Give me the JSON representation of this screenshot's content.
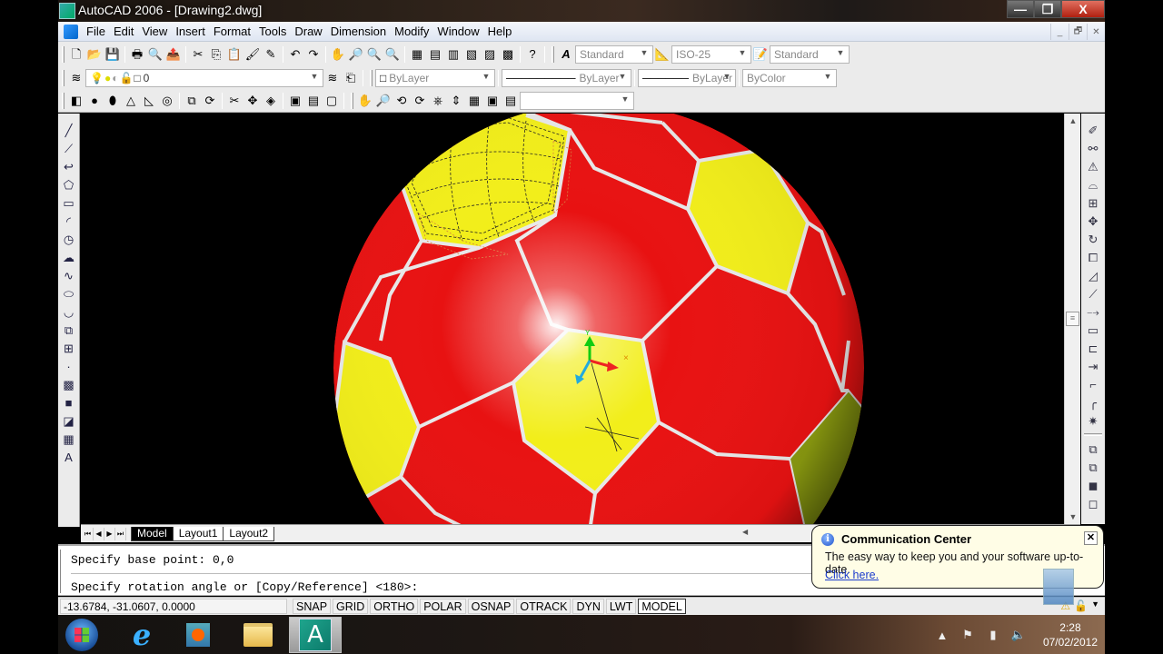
{
  "window": {
    "title": "AutoCAD 2006 - [Drawing2.dwg]",
    "controls": {
      "minimize": "—",
      "restore": "❐",
      "close": "X"
    },
    "mdi_controls": {
      "minimize": "_",
      "restore": "🗗",
      "close": "✕"
    }
  },
  "menubar": {
    "items": [
      "File",
      "Edit",
      "View",
      "Insert",
      "Format",
      "Tools",
      "Draw",
      "Dimension",
      "Modify",
      "Window",
      "Help"
    ]
  },
  "toolbars": {
    "standard_icons": [
      {
        "name": "new-icon",
        "glyph": "🗋"
      },
      {
        "name": "open-icon",
        "glyph": "📂"
      },
      {
        "name": "save-icon",
        "glyph": "💾"
      },
      {
        "name": "plot-icon",
        "glyph": "🖶"
      },
      {
        "name": "plot-preview-icon",
        "glyph": "🔍"
      },
      {
        "name": "publish-icon",
        "glyph": "📤"
      },
      {
        "name": "cut-icon",
        "glyph": "✂"
      },
      {
        "name": "copy-icon",
        "glyph": "⎘"
      },
      {
        "name": "paste-icon",
        "glyph": "📋"
      },
      {
        "name": "match-properties-icon",
        "glyph": "🖌"
      },
      {
        "name": "block-editor-icon",
        "glyph": "✎"
      },
      {
        "name": "undo-icon",
        "glyph": "↶"
      },
      {
        "name": "redo-icon",
        "glyph": "↷"
      },
      {
        "name": "pan-icon",
        "glyph": "✋"
      },
      {
        "name": "zoom-realtime-icon",
        "glyph": "🔎"
      },
      {
        "name": "zoom-window-icon",
        "glyph": "🔍"
      },
      {
        "name": "zoom-previous-icon",
        "glyph": "🔍"
      },
      {
        "name": "properties-icon",
        "glyph": "▦"
      },
      {
        "name": "design-center-icon",
        "glyph": "▤"
      },
      {
        "name": "tool-palettes-icon",
        "glyph": "▥"
      },
      {
        "name": "sheet-set-icon",
        "glyph": "▧"
      },
      {
        "name": "markup-icon",
        "glyph": "▨"
      },
      {
        "name": "calculator-icon",
        "glyph": "▩"
      },
      {
        "name": "help-icon",
        "glyph": "?"
      }
    ],
    "styles": {
      "text_style": "Standard",
      "dim_style": "ISO-25",
      "table_style": "Standard"
    },
    "layers": {
      "current_layer": "0",
      "layer_state_icons": [
        "💡",
        "●",
        "◐",
        "🔓",
        "□"
      ]
    },
    "properties": {
      "color": "ByLayer",
      "linetype": "ByLayer",
      "lineweight": "ByLayer",
      "plotstyle": "ByColor"
    },
    "solids_icons": [
      {
        "name": "box-icon",
        "glyph": "◧"
      },
      {
        "name": "sphere-icon",
        "glyph": "●"
      },
      {
        "name": "cylinder-icon",
        "glyph": "⬮"
      },
      {
        "name": "cone-icon",
        "glyph": "△"
      },
      {
        "name": "wedge-icon",
        "glyph": "◺"
      },
      {
        "name": "torus-icon",
        "glyph": "◎"
      },
      {
        "name": "extrude-icon",
        "glyph": "⧉"
      },
      {
        "name": "revolve-icon",
        "glyph": "⟳"
      },
      {
        "name": "slice-icon",
        "glyph": "✂"
      },
      {
        "name": "section-icon",
        "glyph": "✥"
      },
      {
        "name": "interference-icon",
        "glyph": "◈"
      },
      {
        "name": "setup-drawing-icon",
        "glyph": "▣"
      },
      {
        "name": "setup-view-icon",
        "glyph": "▤"
      },
      {
        "name": "setup-profile-icon",
        "glyph": "▢"
      }
    ],
    "orbit_icons": [
      {
        "name": "3d-pan-icon",
        "glyph": "✋"
      },
      {
        "name": "3d-zoom-icon",
        "glyph": "🔎"
      },
      {
        "name": "3d-orbit-icon",
        "glyph": "⟲"
      },
      {
        "name": "3d-continuous-orbit-icon",
        "glyph": "⟳"
      },
      {
        "name": "3d-swivel-icon",
        "glyph": "⎈"
      },
      {
        "name": "3d-adjust-distance-icon",
        "glyph": "⇕"
      },
      {
        "name": "3d-clip-icon",
        "glyph": "▦"
      },
      {
        "name": "front-clip-icon",
        "glyph": "▣"
      },
      {
        "name": "back-clip-icon",
        "glyph": "▤"
      }
    ],
    "view_combo": ""
  },
  "draw_tools": [
    {
      "name": "line-icon",
      "glyph": "╱"
    },
    {
      "name": "construction-line-icon",
      "glyph": "⟋"
    },
    {
      "name": "polyline-icon",
      "glyph": "↩"
    },
    {
      "name": "polygon-icon",
      "glyph": "⬠"
    },
    {
      "name": "rectangle-icon",
      "glyph": "▭"
    },
    {
      "name": "arc-icon",
      "glyph": "◜"
    },
    {
      "name": "circle-icon",
      "glyph": "◷"
    },
    {
      "name": "revision-cloud-icon",
      "glyph": "☁"
    },
    {
      "name": "spline-icon",
      "glyph": "∿"
    },
    {
      "name": "ellipse-icon",
      "glyph": "⬭"
    },
    {
      "name": "ellipse-arc-icon",
      "glyph": "◡"
    },
    {
      "name": "insert-block-icon",
      "glyph": "⧉"
    },
    {
      "name": "make-block-icon",
      "glyph": "⊞"
    },
    {
      "name": "point-icon",
      "glyph": "·"
    },
    {
      "name": "hatch-icon",
      "glyph": "▩"
    },
    {
      "name": "gradient-icon",
      "glyph": "■"
    },
    {
      "name": "region-icon",
      "glyph": "◪"
    },
    {
      "name": "table-icon",
      "glyph": "▦"
    },
    {
      "name": "multiline-text-icon",
      "glyph": "A"
    }
  ],
  "modify_tools": [
    {
      "name": "erase-icon",
      "glyph": "✐"
    },
    {
      "name": "copy-object-icon",
      "glyph": "⚯"
    },
    {
      "name": "mirror-icon",
      "glyph": "⚠"
    },
    {
      "name": "offset-icon",
      "glyph": "⌓"
    },
    {
      "name": "array-icon",
      "glyph": "⊞"
    },
    {
      "name": "move-icon",
      "glyph": "✥"
    },
    {
      "name": "rotate-icon",
      "glyph": "↻"
    },
    {
      "name": "scale-icon",
      "glyph": "⧠"
    },
    {
      "name": "stretch-icon",
      "glyph": "◿"
    },
    {
      "name": "trim-icon",
      "glyph": "⟋"
    },
    {
      "name": "extend-icon",
      "glyph": "⤍"
    },
    {
      "name": "break-at-point-icon",
      "glyph": "▭"
    },
    {
      "name": "break-icon",
      "glyph": "⊏"
    },
    {
      "name": "join-icon",
      "glyph": "⇥"
    },
    {
      "name": "chamfer-icon",
      "glyph": "⌐"
    },
    {
      "name": "fillet-icon",
      "glyph": "╭"
    },
    {
      "name": "explode-icon",
      "glyph": "✷"
    }
  ],
  "draworder_tools": [
    {
      "name": "bring-to-front-icon",
      "glyph": "⧉"
    },
    {
      "name": "send-to-back-icon",
      "glyph": "⧉"
    },
    {
      "name": "bring-above-icon",
      "glyph": "◼"
    },
    {
      "name": "send-under-icon",
      "glyph": "◻"
    }
  ],
  "layout_tabs": {
    "nav": [
      "⏮",
      "◀",
      "▶",
      "⏭"
    ],
    "tabs": [
      "Model",
      "Layout1",
      "Layout2"
    ],
    "active": "Model"
  },
  "command_line": {
    "history": "Specify base point: 0,0",
    "prompt": "Specify rotation angle or [Copy/Reference] <180>:"
  },
  "status_bar": {
    "coordinates": "-13.6784, -31.0607, 0.0000",
    "toggles": [
      "SNAP",
      "GRID",
      "ORTHO",
      "POLAR",
      "OSNAP",
      "OTRACK",
      "DYN",
      "LWT",
      "MODEL"
    ]
  },
  "communication_center": {
    "title": "Communication Center",
    "message": "The easy way to keep you and your software up-to-date.",
    "link": "Click here.",
    "close": "✕"
  },
  "scene": {
    "ball_colors": {
      "red": "#e81212",
      "yellow": "#f2ee1a",
      "seam": "#e8e8e8",
      "background": "#000000"
    }
  },
  "taskbar": {
    "apps": [
      "Start",
      "Internet Explorer",
      "Windows Media Player",
      "Windows Explorer",
      "AutoCAD 2006"
    ],
    "tray": {
      "time": "2:28",
      "date": "07/02/2012"
    }
  }
}
